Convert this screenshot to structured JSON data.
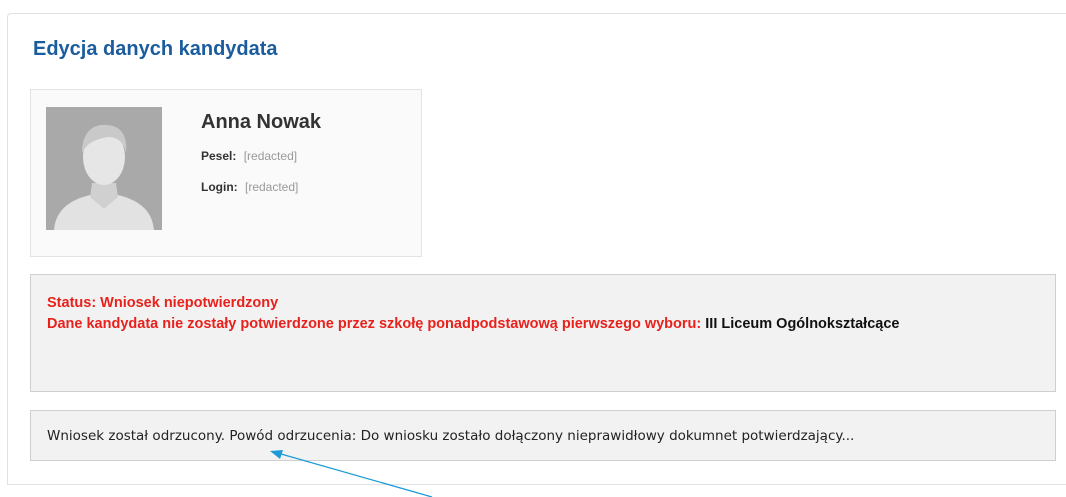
{
  "page": {
    "title": "Edycja danych kandydata"
  },
  "candidate": {
    "name": "Anna Nowak",
    "pesel_label": "Pesel:",
    "pesel_value": "[redacted]",
    "login_label": "Login:",
    "login_value": "[redacted]",
    "avatar_icon": "user-placeholder-icon"
  },
  "status": {
    "status_line": "Status: Wniosek niepotwierdzony",
    "details_prefix": "Dane kandydata nie zostały potwierdzone przez szkołę ponadpodstawową pierwszego wyboru:",
    "school_name": "III Liceum Ogólnokształcące",
    "color": "#e8211c"
  },
  "message": {
    "text": "Wniosek został odrzucony. Powód odrzucenia: Do wniosku zostało dołączony nieprawidłowy dokumnet potwierdzający..."
  },
  "colors": {
    "title": "#1b5c9e",
    "annotation_arrow": "#1e9bd7"
  }
}
